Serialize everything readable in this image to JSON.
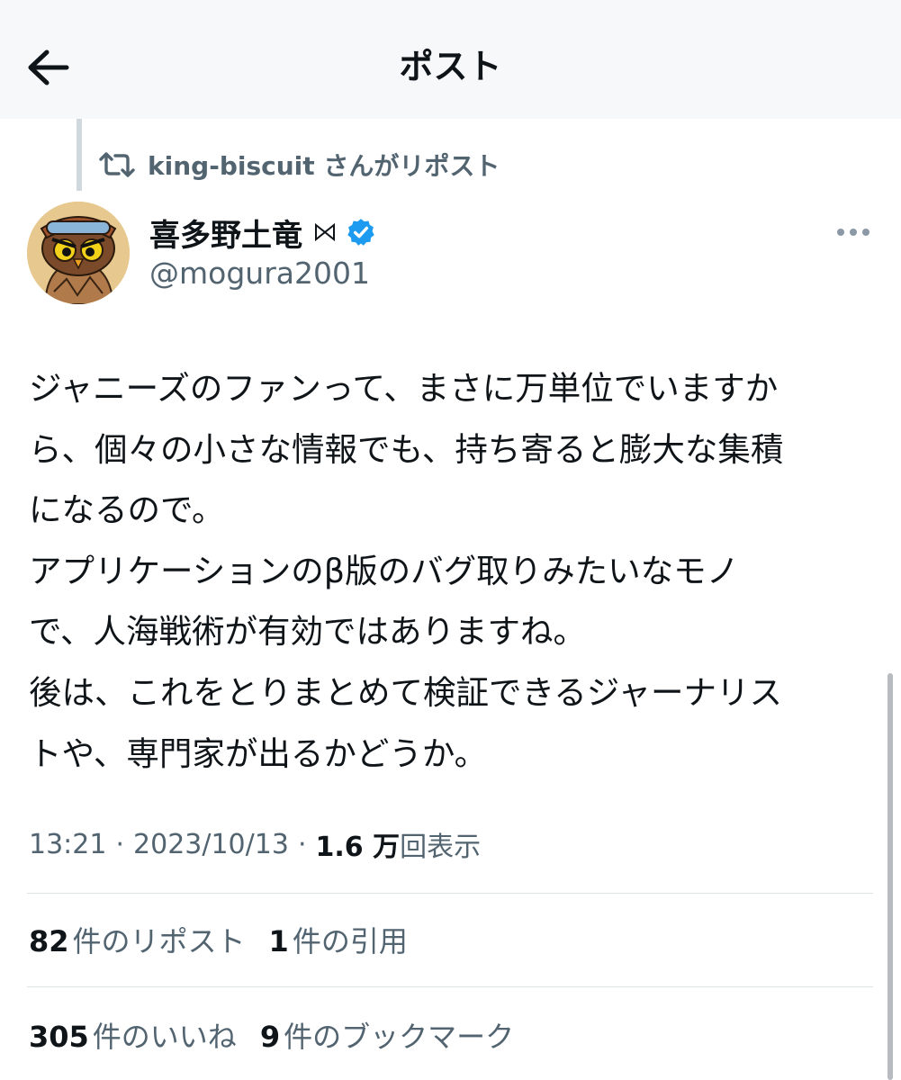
{
  "header": {
    "title": "ポスト"
  },
  "repost": {
    "text": "king-biscuit さんがリポスト"
  },
  "author": {
    "name": "喜多野土竜",
    "handle": "@mogura2001",
    "verified": true
  },
  "post": {
    "lines": [
      "ジャニーズのファンって、まさに万単位でいますか",
      "ら、個々の小さな情報でも、持ち寄ると膨大な集積",
      "になるので。",
      "アプリケーションのβ版のバグ取りみたいなモノ",
      "で、人海戦術が有効ではありますね。",
      "後は、これをとりまとめて検証できるジャーナリス",
      "トや、専門家が出るかどうか。"
    ]
  },
  "meta": {
    "time": "13:21",
    "date": "2023/10/13",
    "separator": "·",
    "views_count": "1.6 万",
    "views_label": "回表示"
  },
  "stats": {
    "reposts_count": "82",
    "reposts_label": "件のリポスト",
    "quotes_count": "1",
    "quotes_label": "件の引用",
    "likes_count": "305",
    "likes_label": "件のいいね",
    "bookmarks_count": "9",
    "bookmarks_label": "件のブックマーク"
  },
  "colors": {
    "text_primary": "#0f1419",
    "text_secondary": "#536471",
    "verified_blue": "#1d9bf0",
    "divider": "#dfe4e7"
  },
  "icons": {
    "back": "arrow-left-icon",
    "repost": "repost-icon",
    "verified": "verified-badge-icon",
    "more": "more-horizontal-icon",
    "bowtie": "bowtie-icon"
  }
}
